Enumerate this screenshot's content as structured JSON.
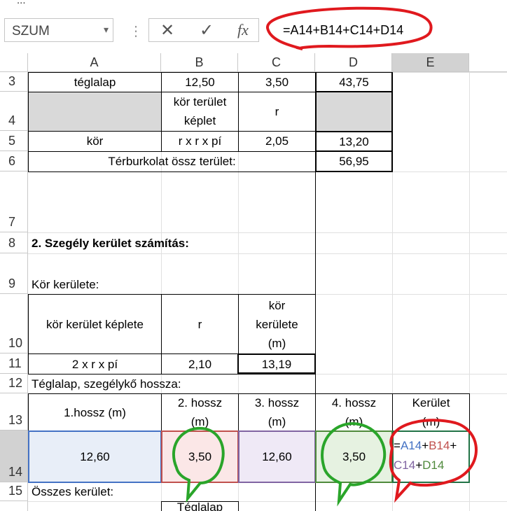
{
  "top_strip_text": "...",
  "name_box": {
    "value": "SZUM",
    "arrow": "▾"
  },
  "formula_bar": {
    "cancel_icon": "✕",
    "enter_icon": "✓",
    "fx_label": "fx",
    "formula": "=A14+B14+C14+D14"
  },
  "columns": [
    "A",
    "B",
    "C",
    "D",
    "E"
  ],
  "rows": [
    "3",
    "4",
    "5",
    "6",
    "7",
    "8",
    "9",
    "10",
    "11",
    "12",
    "13",
    "14",
    "15"
  ],
  "cells": {
    "A3": "téglalap",
    "B3": "12,50",
    "C3": "3,50",
    "D3": "43,75",
    "B4": "kör terület képlet",
    "C4": "r",
    "A5": "kör",
    "B5": "r x r x pí",
    "C5": "2,05",
    "D5": "13,20",
    "A6": "Térburkolat össz terület:",
    "D6": "56,95",
    "A8": "2. Szegély kerület számítás:",
    "A9": "Kör kerülete:",
    "A10": "kör kerület képlete",
    "B10": "r",
    "C10": "kör kerülete (m)",
    "A11": "2 x r x pí",
    "B11": "2,10",
    "C11": "13,19",
    "A12": "Téglalap, szegélykő hossza:",
    "A13": "1.hossz (m)",
    "B13": "2. hossz (m)",
    "C13": "3. hossz (m)",
    "D13": "4. hossz (m)",
    "E13": "Kerület (m)",
    "A14": "12,60",
    "B14": "3,50",
    "C14": "12,60",
    "D14": "3,50",
    "E14_parts": [
      "=",
      "A14",
      "+",
      "B14",
      "+",
      "C14",
      "+",
      "D14"
    ],
    "A15": "Összes kerület:",
    "B16": "Téglalap"
  },
  "colors": {
    "ref_A": "#4472c4",
    "ref_B": "#c0504d",
    "ref_C": "#8064a2",
    "ref_D": "#4f8a3c",
    "annot_red": "#e0191e",
    "annot_green": "#2aa52a"
  }
}
